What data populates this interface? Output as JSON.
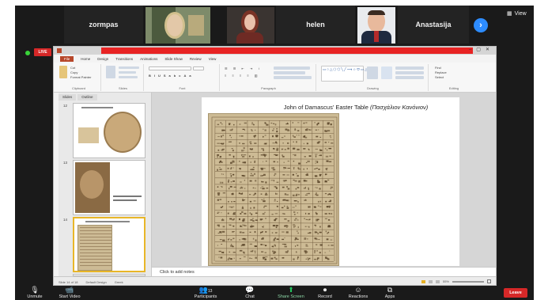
{
  "participants": [
    {
      "name": "zormpas"
    },
    {
      "name": ""
    },
    {
      "name": ""
    },
    {
      "name": "helen"
    },
    {
      "name": ""
    },
    {
      "name": "Anastasija"
    }
  ],
  "view_label": "View",
  "live_label": "LIVE",
  "ribbon": {
    "tabs": [
      "File",
      "Home",
      "Design",
      "Transitions",
      "Animations",
      "Slide Show",
      "Review",
      "View"
    ],
    "groups": [
      "Clipboard",
      "Slides",
      "Font",
      "Paragraph",
      "Drawing",
      "Editing"
    ],
    "clipboard": [
      "Cut",
      "Copy",
      "Format Painter"
    ],
    "editing": [
      "Find",
      "Replace",
      "Select"
    ]
  },
  "pane_tabs": [
    "Slides",
    "Outline"
  ],
  "slide_numbers": [
    "12",
    "13",
    "14"
  ],
  "slide": {
    "title": "John of Damascus' Easter Table",
    "title_greek": "(Πασχάλιον Κανόνιον)"
  },
  "notes_placeholder": "Click to add notes",
  "status_bar": {
    "slide_info": "Slide 14 of 18",
    "theme": "Default Design",
    "language": "Greek",
    "zoom": "55%"
  },
  "toolbar": {
    "items": [
      {
        "label": "Unmute",
        "icon": "microphone-muted-icon"
      },
      {
        "label": "Start Video",
        "icon": "video-off-icon"
      },
      {
        "label": "Participants",
        "icon": "participants-icon",
        "count": "13"
      },
      {
        "label": "Chat",
        "icon": "chat-icon"
      },
      {
        "label": "Share Screen",
        "icon": "share-screen-icon"
      },
      {
        "label": "Record",
        "icon": "record-icon"
      },
      {
        "label": "Reactions",
        "icon": "reactions-icon"
      },
      {
        "label": "Apps",
        "icon": "apps-icon"
      }
    ],
    "leave": "Leave",
    "share_screen_color": "#22c55e"
  },
  "colors": {
    "share_bar": "#e82323",
    "leave": "#d62828",
    "zoom_blue": "#2d8cff"
  }
}
